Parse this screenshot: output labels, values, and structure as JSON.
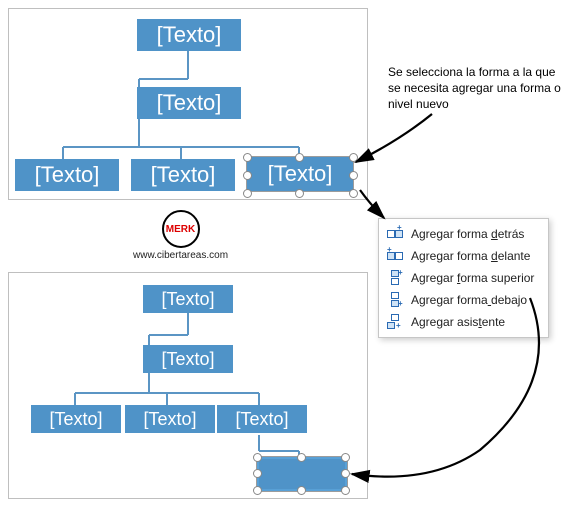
{
  "placeholder": "[Texto]",
  "annotation": "Se selecciona la forma a la que se necesita agregar una forma o nivel nuevo",
  "logo_text": "MERK",
  "logo_url": "www.cibertareas.com",
  "menu": {
    "items": [
      {
        "label": "Agregar forma detrás",
        "accel_index": 14
      },
      {
        "label": "Agregar forma delante",
        "accel_index": 14
      },
      {
        "label": "Agregar forma superior",
        "accel_index": 8
      },
      {
        "label": "Agregar forma debajo",
        "accel_index": 13
      },
      {
        "label": "Agregar asistente",
        "accel_index": 12
      }
    ]
  },
  "colors": {
    "node": "#4f93c8",
    "line": "#5b95c4"
  },
  "chart_data": [
    {
      "type": "tree",
      "title": "before",
      "levels": [
        [
          1
        ],
        [
          1
        ],
        [
          3
        ]
      ],
      "selected": [
        2,
        2
      ]
    },
    {
      "type": "tree",
      "title": "after",
      "levels": [
        [
          1
        ],
        [
          1
        ],
        [
          3
        ],
        [
          1
        ]
      ],
      "selected": null
    }
  ]
}
